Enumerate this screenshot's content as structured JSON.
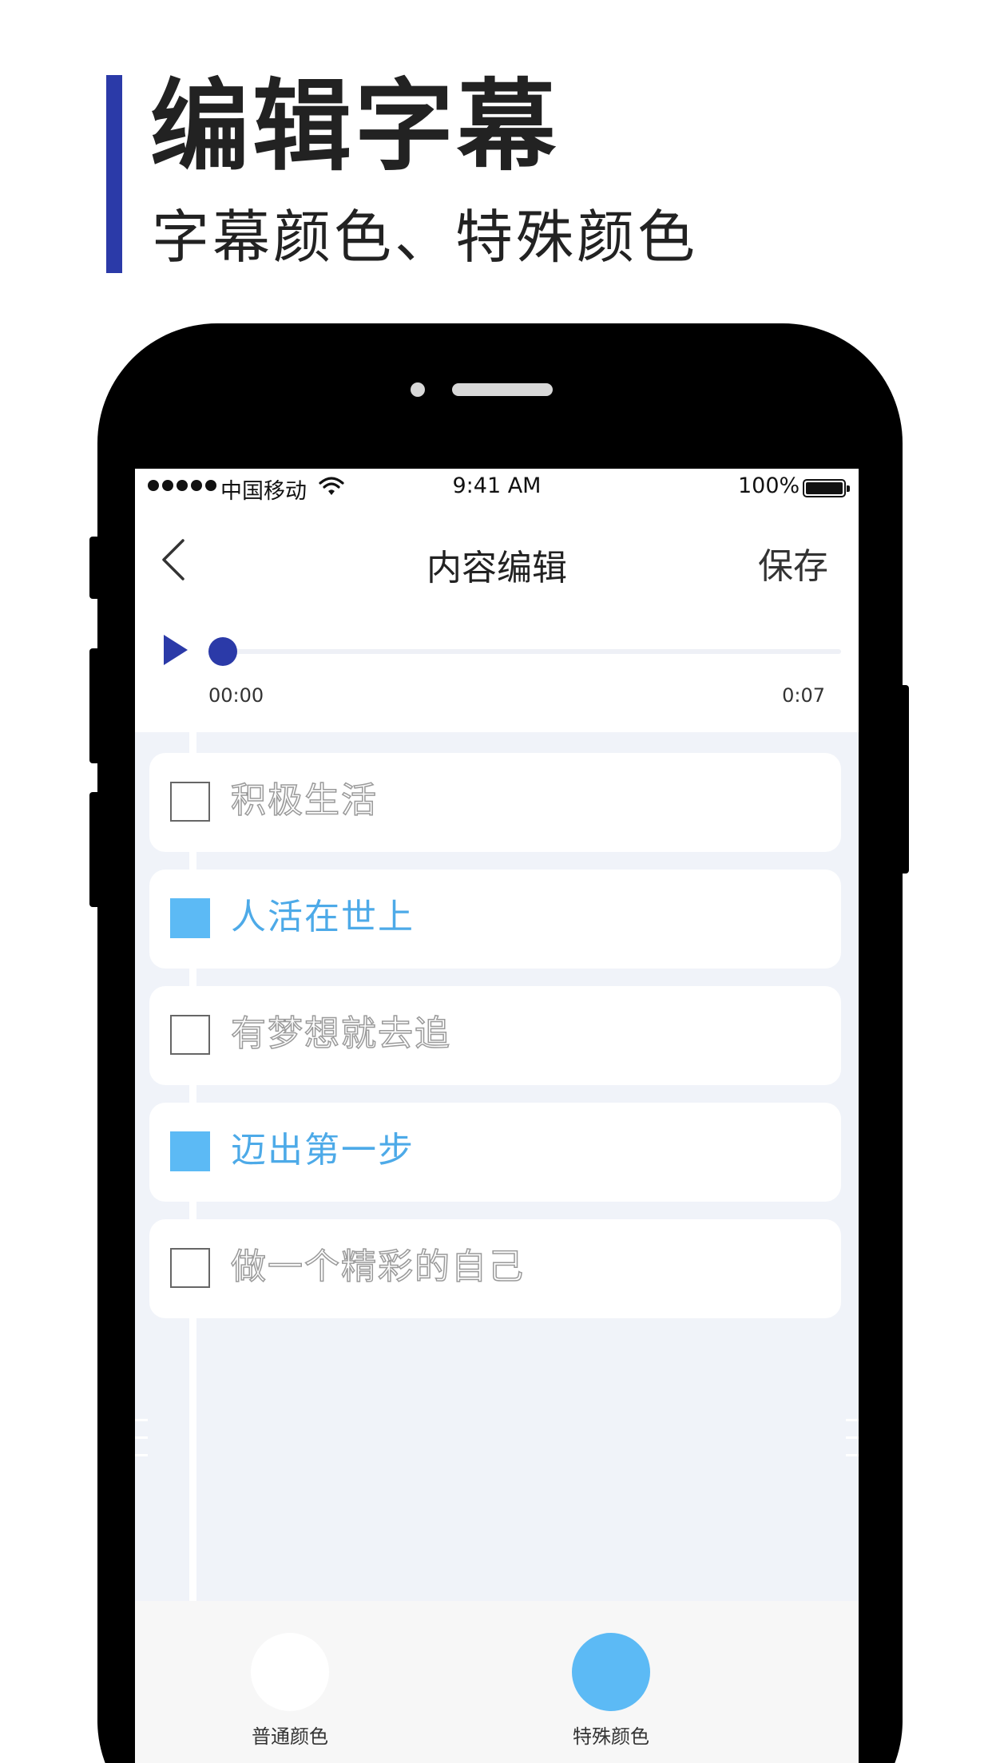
{
  "promo": {
    "title": "编辑字幕",
    "subtitle": "字幕颜色、特殊颜色"
  },
  "status_bar": {
    "carrier": "中国移动",
    "time": "9:41 AM",
    "battery": "100%"
  },
  "nav": {
    "back_icon": "chevron-left-icon",
    "title": "内容编辑",
    "save_label": "保存"
  },
  "player": {
    "play_icon": "play-icon",
    "current_time": "00:00",
    "end_time": "0:07",
    "progress": 0
  },
  "subtitles": [
    {
      "text": "积极生活",
      "special": false
    },
    {
      "text": "人活在世上",
      "special": true
    },
    {
      "text": "有梦想就去追",
      "special": false
    },
    {
      "text": "迈出第一步",
      "special": true
    },
    {
      "text": "做一个精彩的自己",
      "special": false
    }
  ],
  "color_options": [
    {
      "label": "普通颜色",
      "color": "#ffffff"
    },
    {
      "label": "特殊颜色",
      "color": "#5cbaf5"
    }
  ],
  "colors": {
    "accent": "#2b3aa8",
    "special": "#5cbaf5"
  }
}
